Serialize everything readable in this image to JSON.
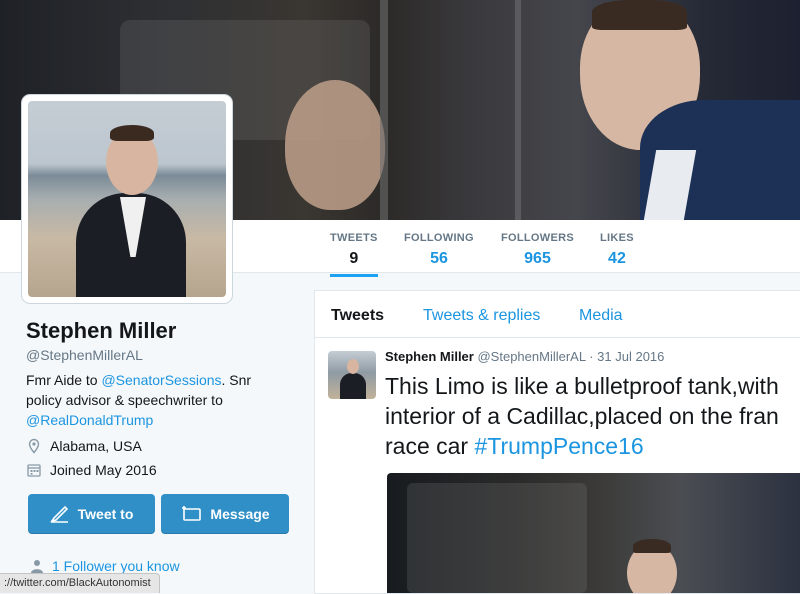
{
  "profile": {
    "name": "Stephen Miller",
    "handle": "@StephenMillerAL",
    "bio_prefix": "Fmr Aide to ",
    "bio_link1": "@SenatorSessions",
    "bio_mid": ". Snr policy advisor & speechwriter to ",
    "bio_link2": "@RealDonaldTrump",
    "location": "Alabama, USA",
    "joined": "Joined May 2016",
    "tweet_to_label": "Tweet to",
    "message_label": "Message",
    "follower_text": "1 Follower you know"
  },
  "stats": [
    {
      "label": "TWEETS",
      "value": "9"
    },
    {
      "label": "FOLLOWING",
      "value": "56"
    },
    {
      "label": "FOLLOWERS",
      "value": "965"
    },
    {
      "label": "LIKES",
      "value": "42"
    }
  ],
  "timeline": {
    "tabs": [
      "Tweets",
      "Tweets & replies",
      "Media"
    ],
    "tweet": {
      "name": "Stephen Miller",
      "handle": "@StephenMillerAL",
      "date": "· 31 Jul 2016",
      "line1": "This Limo is like a bulletproof tank,with",
      "line2": "interior of a Cadillac,placed on the fran",
      "line3_prefix": "race car ",
      "hashtag": "#TrumpPence16"
    }
  },
  "status_url": "://twitter.com/BlackAutonomist",
  "colors": {
    "link": "#1b95e0",
    "button": "#2f8fc6",
    "active_tab_underline": "#1da1f2"
  }
}
